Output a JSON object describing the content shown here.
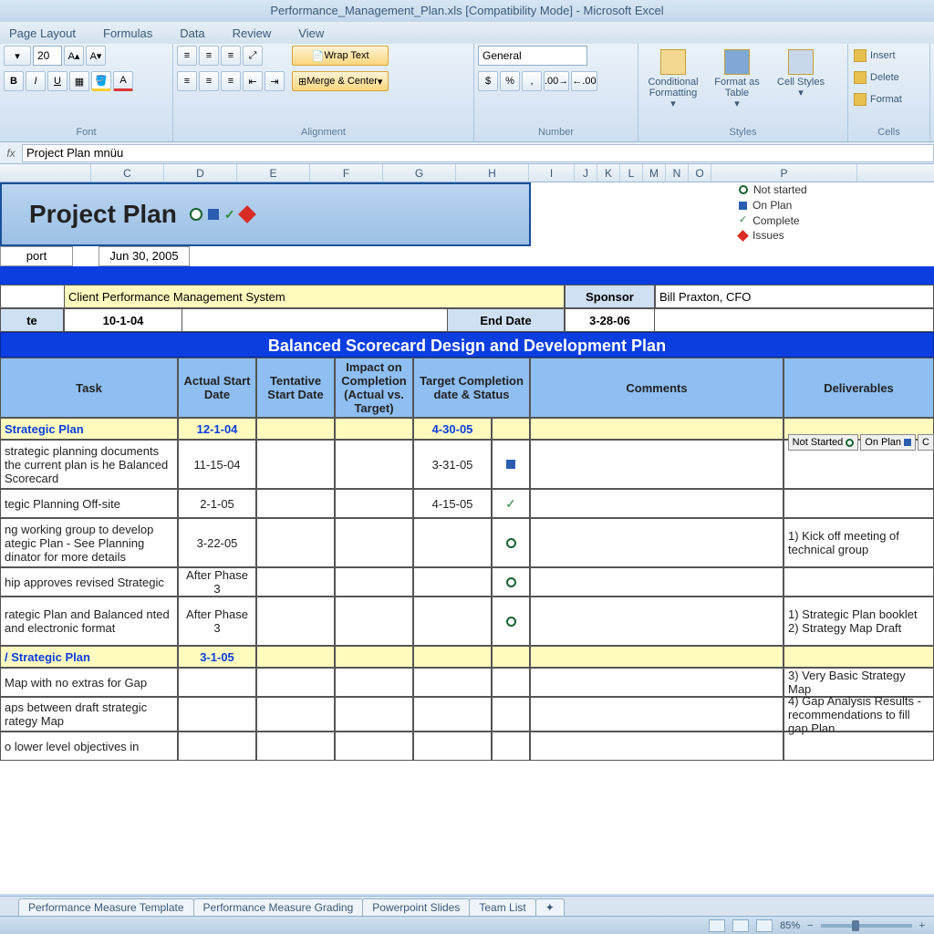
{
  "app": {
    "title": "Performance_Management_Plan.xls  [Compatibility Mode] - Microsoft Excel"
  },
  "menu": [
    "Page Layout",
    "Formulas",
    "Data",
    "Review",
    "View"
  ],
  "ribbon": {
    "font_size": "20",
    "wrap": "Wrap Text",
    "merge": "Merge & Center",
    "number_format": "General",
    "cond_fmt": "Conditional Formatting",
    "fmt_table": "Format as Table",
    "cell_styles": "Cell Styles",
    "insert": "Insert",
    "delete": "Delete",
    "format": "Format",
    "groups": {
      "font": "Font",
      "alignment": "Alignment",
      "number": "Number",
      "styles": "Styles",
      "cells": "Cells"
    }
  },
  "formula_bar": {
    "value": "Project Plan  mnüu"
  },
  "columns": [
    "C",
    "D",
    "E",
    "F",
    "G",
    "H",
    "I",
    "J",
    "K",
    "L",
    "M",
    "N",
    "O",
    "P"
  ],
  "plan": {
    "title": "Project Plan",
    "legend": {
      "not_started": "Not started",
      "on_plan": "On Plan",
      "complete": "Complete",
      "issues": "Issues"
    },
    "port": "port",
    "port_date": "Jun 30, 2005",
    "client_label_val": "Client Performance Management System",
    "sponsor_label": "Sponsor",
    "sponsor_val": "Bill Praxton, CFO",
    "date_label": "te",
    "start_date": "10-1-04",
    "end_label": "End Date",
    "end_date": "3-28-06",
    "section_title": "Balanced Scorecard Design and Development Plan",
    "status_btns": {
      "ns": "Not Started",
      "op": "On Plan",
      "c": "C"
    }
  },
  "table": {
    "headers": {
      "task": "Task",
      "actual": "Actual Start Date",
      "tentative": "Tentative Start Date",
      "impact": "Impact on Completion (Actual vs. Target)",
      "target": "Target Completion date & Status",
      "comments": "Comments",
      "deliverables": "Deliverables"
    },
    "rows": [
      {
        "type": "section",
        "task": "Strategic Plan",
        "actual": "12-1-04",
        "target": "4-30-05"
      },
      {
        "task": "strategic planning documents the current plan is he Balanced Scorecard",
        "actual": "11-15-04",
        "target": "3-31-05",
        "status": "square"
      },
      {
        "task": "tegic Planning Off-site",
        "actual": "2-1-05",
        "target": "4-15-05",
        "status": "check"
      },
      {
        "task": "ng working group to develop ategic Plan - See Planning dinator for more details",
        "actual": "3-22-05",
        "status": "circle",
        "deliv": "1) Kick off meeting of technical group"
      },
      {
        "task": "hip approves revised Strategic",
        "actual": "After Phase 3",
        "status": "circle"
      },
      {
        "task": "rategic Plan and Balanced nted and electronic format",
        "actual": "After Phase 3",
        "status": "circle",
        "deliv": "1) Strategic Plan booklet 2) Strategy Map Draft"
      },
      {
        "type": "section",
        "task": "/ Strategic Plan",
        "actual": "3-1-05"
      },
      {
        "task": "Map with no extras for Gap",
        "deliv": "3) Very Basic Strategy Map"
      },
      {
        "task": "aps between draft strategic rategy Map",
        "deliv": "4) Gap Analysis Results - recommendations to fill gap Plan"
      },
      {
        "task": "o lower level objectives in"
      }
    ]
  },
  "sheet_tabs": [
    "Performance Measure Template",
    "Performance Measure Grading",
    "Powerpoint Slides",
    "Team List"
  ],
  "statusbar": {
    "zoom": "85%"
  }
}
